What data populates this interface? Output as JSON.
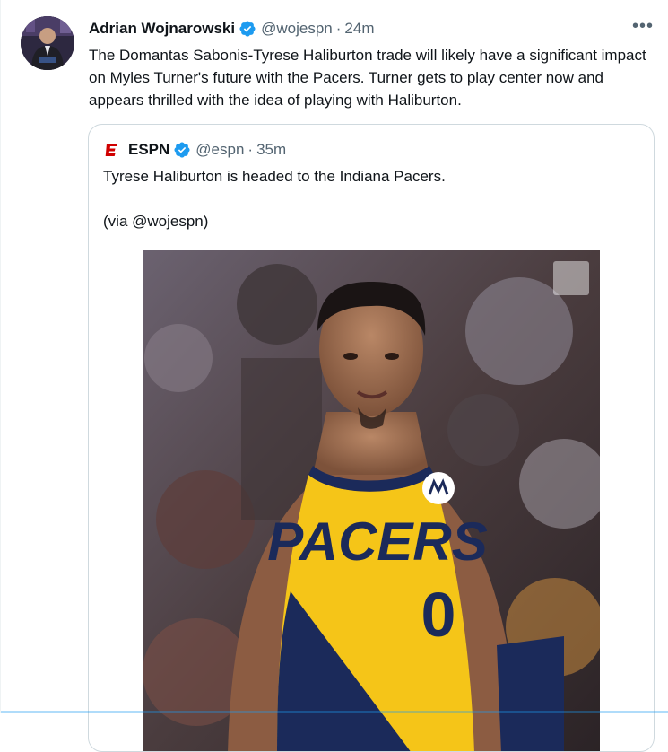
{
  "tweet": {
    "author_name": "Adrian Wojnarowski",
    "author_handle": "@wojespn",
    "separator": "·",
    "time": "24m",
    "more_label": "•••",
    "text": "The Domantas Sabonis-Tyrese Haliburton trade will likely have a significant impact on Myles Turner's future with the Pacers. Turner gets to play center now and appears thrilled with the idea of playing with Haliburton."
  },
  "quoted_tweet": {
    "author_name": "ESPN",
    "author_handle": "@espn",
    "separator": "·",
    "time": "35m",
    "text_line1": "Tyrese Haliburton is headed to the Indiana Pacers.",
    "text_line2": "(via @wojespn)",
    "jersey_text": "PACERS",
    "jersey_number": "0"
  },
  "colors": {
    "accent": "#1d9bf0",
    "espn_red": "#d00000",
    "pacers_navy": "#1b2a5a",
    "pacers_gold": "#f5c518"
  }
}
